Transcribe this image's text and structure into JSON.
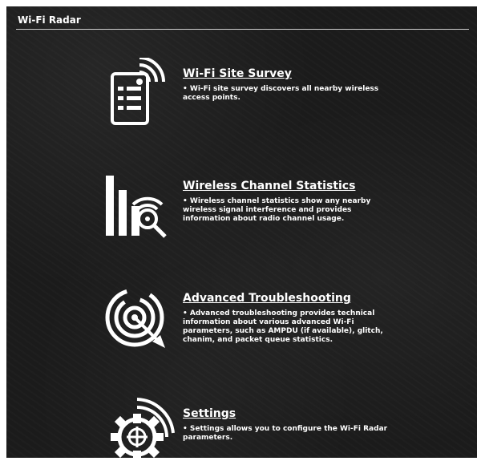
{
  "header": {
    "title": "Wi-Fi Radar"
  },
  "sections": [
    {
      "title": "Wi-Fi Site Survey",
      "description": "• Wi-Fi site survey discovers all nearby wireless access points.",
      "icon": "site-survey-icon"
    },
    {
      "title": "Wireless Channel Statistics",
      "description": "• Wireless channel statistics show any nearby wireless signal interference and provides information about radio channel usage.",
      "icon": "channel-statistics-icon"
    },
    {
      "title": "Advanced Troubleshooting",
      "description": "• Advanced troubleshooting provides technical information about various advanced Wi-Fi parameters, such as AMPDU (if available), glitch, chanim, and packet queue statistics.",
      "icon": "troubleshooting-icon"
    },
    {
      "title": "Settings",
      "description": "• Settings allows you to configure the Wi-Fi Radar parameters.",
      "icon": "settings-gear-icon"
    }
  ]
}
